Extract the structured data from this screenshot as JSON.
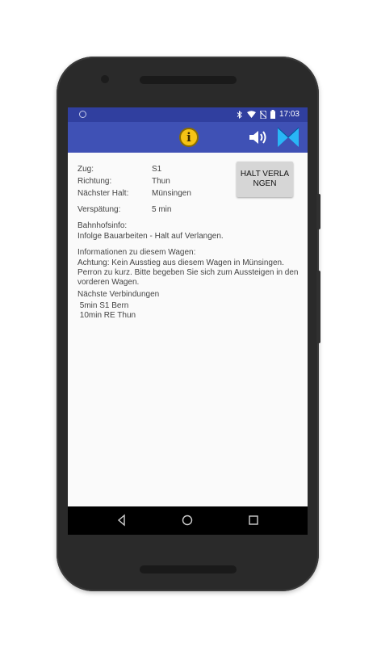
{
  "status_bar": {
    "time": "17:03"
  },
  "app_bar": {
    "info_button": "i"
  },
  "trip": {
    "zug_label": "Zug:",
    "zug_value": "S1",
    "richtung_label": "Richtung:",
    "richtung_value": "Thun",
    "halt_label": "Nächster Halt:",
    "halt_value": "Münsingen",
    "verspaetung_label": "Verspätung:",
    "verspaetung_value": "5 min"
  },
  "halt_button": "HALT VERLANGEN",
  "bahnhof": {
    "title": "Bahnhofsinfo:",
    "text": "Infolge Bauarbeiten - Halt auf Verlangen."
  },
  "wagen": {
    "title": "Informationen zu diesem Wagen:",
    "text": "Achtung: Kein Ausstieg aus diesem Wagen in Münsingen. Perron zu kurz. Bitte begeben Sie sich zum Aussteigen in den vorderen Wagen."
  },
  "verbindungen": {
    "title": "Nächste Verbindungen",
    "items": [
      " 5min S1 Bern",
      " 10min RE Thun"
    ]
  },
  "colors": {
    "status_bar": "#303f9f",
    "app_bar": "#3f51b5",
    "info_icon": "#f5c315"
  }
}
